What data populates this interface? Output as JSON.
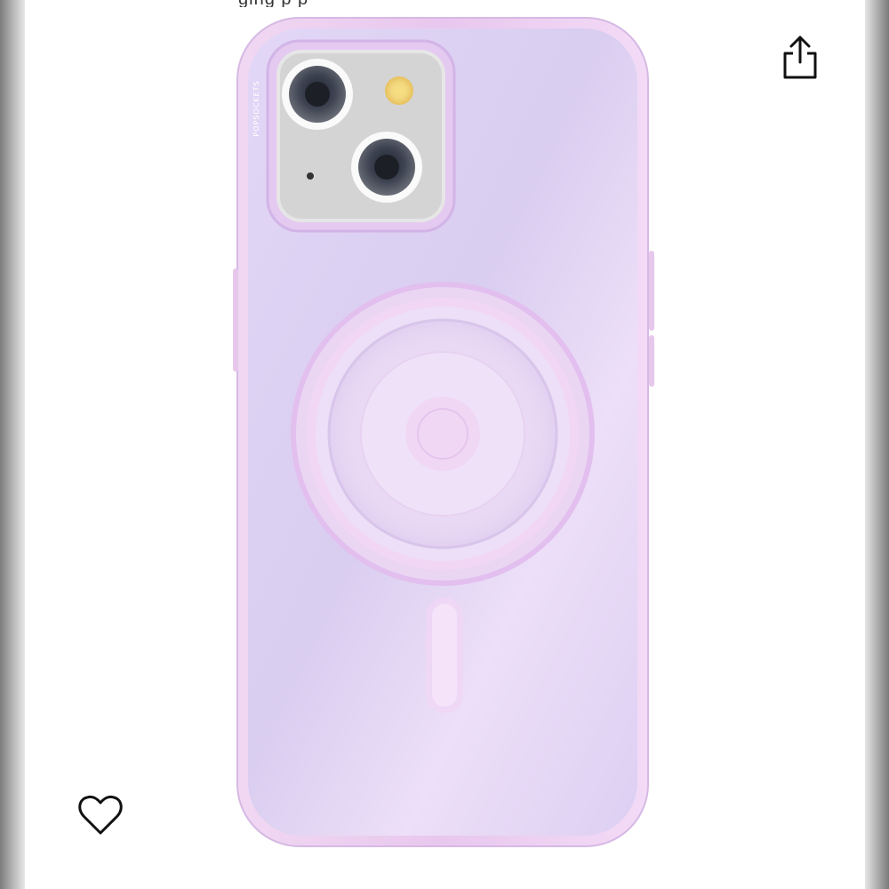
{
  "header": {
    "title_partial": "ging  p  p"
  },
  "product": {
    "brand_mark": "POPSOCKETS",
    "image_alt": "Lavender phone case with grip",
    "colors": {
      "case": "#ddd0f2",
      "case_edge": "#e9c4ec",
      "lens_ring": "#f5f5f5"
    }
  },
  "actions": {
    "share_icon": "share-icon",
    "favorite_icon": "heart-outline-icon"
  }
}
